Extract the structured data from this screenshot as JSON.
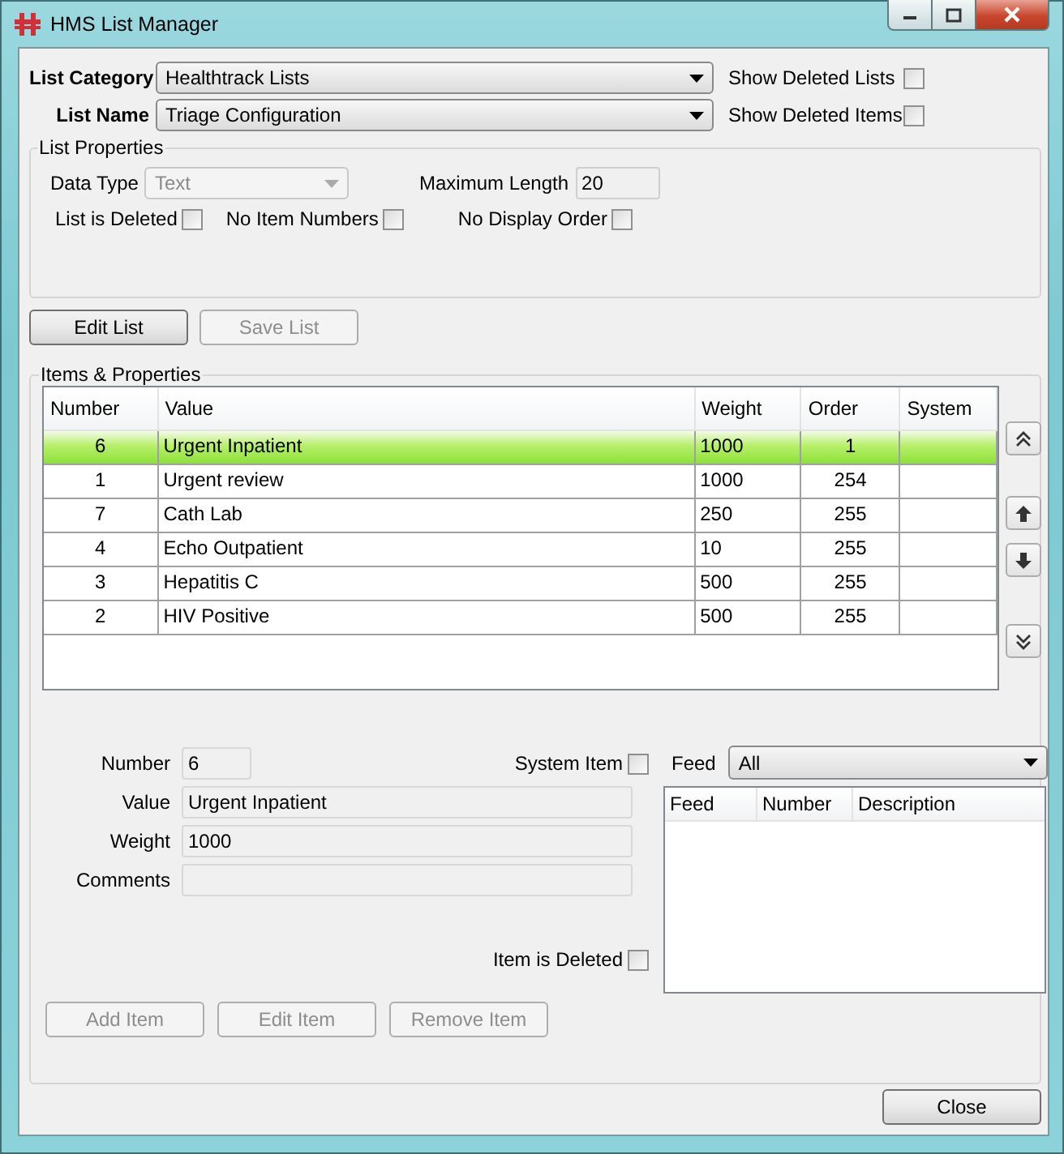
{
  "window": {
    "title": "HMS List Manager"
  },
  "selectors": [
    {
      "label": "List Category",
      "value": "Healthtrack Lists",
      "option": {
        "label": "Show Deleted Lists",
        "checked": false
      }
    },
    {
      "label": "List Name",
      "value": "Triage Configuration",
      "option": {
        "label": "Show Deleted Items",
        "checked": false
      }
    }
  ],
  "list_properties": {
    "title": "List Properties",
    "data_type": {
      "label": "Data Type",
      "value": "Text",
      "disabled": true
    },
    "maximum_length": {
      "label": "Maximum Length",
      "value": "20"
    },
    "checkboxes": [
      {
        "label": "List is Deleted",
        "checked": false
      },
      {
        "label": "No Item Numbers",
        "checked": false
      },
      {
        "label": "No Display Order",
        "checked": false
      }
    ]
  },
  "list_buttons": [
    {
      "label": "Edit List",
      "disabled": false
    },
    {
      "label": "Save List",
      "disabled": true
    }
  ],
  "items": {
    "title": "Items & Properties",
    "columns": [
      "Number",
      "Value",
      "Weight",
      "Order",
      "System"
    ],
    "rows": [
      {
        "cells": [
          "6",
          "Urgent Inpatient",
          "1000",
          "1",
          ""
        ],
        "selected": true
      },
      {
        "cells": [
          "1",
          "Urgent review",
          "1000",
          "254",
          ""
        ],
        "selected": false
      },
      {
        "cells": [
          "7",
          "Cath Lab",
          "250",
          "255",
          ""
        ],
        "selected": false
      },
      {
        "cells": [
          "4",
          "Echo Outpatient",
          "10",
          "255",
          ""
        ],
        "selected": false
      },
      {
        "cells": [
          "3",
          "Hepatitis C",
          "500",
          "255",
          ""
        ],
        "selected": false
      },
      {
        "cells": [
          "2",
          "HIV Positive",
          "500",
          "255",
          ""
        ],
        "selected": false
      }
    ]
  },
  "detail": {
    "fields": [
      {
        "label": "Number",
        "value": "6"
      },
      {
        "label": "Value",
        "value": "Urgent Inpatient"
      },
      {
        "label": "Weight",
        "value": "1000"
      },
      {
        "label": "Comments"
      }
    ],
    "system_item": {
      "label": "System Item",
      "checked": false
    },
    "item_is_deleted": {
      "label": "Item is Deleted",
      "checked": false
    },
    "feed": {
      "label": "Feed",
      "value": "All"
    },
    "feed_columns": [
      "Feed",
      "Number",
      "Description"
    ]
  },
  "item_buttons": [
    {
      "label": "Add Item",
      "disabled": true
    },
    {
      "label": "Edit Item",
      "disabled": true
    },
    {
      "label": "Remove Item",
      "disabled": true
    }
  ],
  "close_button": {
    "label": "Close"
  }
}
